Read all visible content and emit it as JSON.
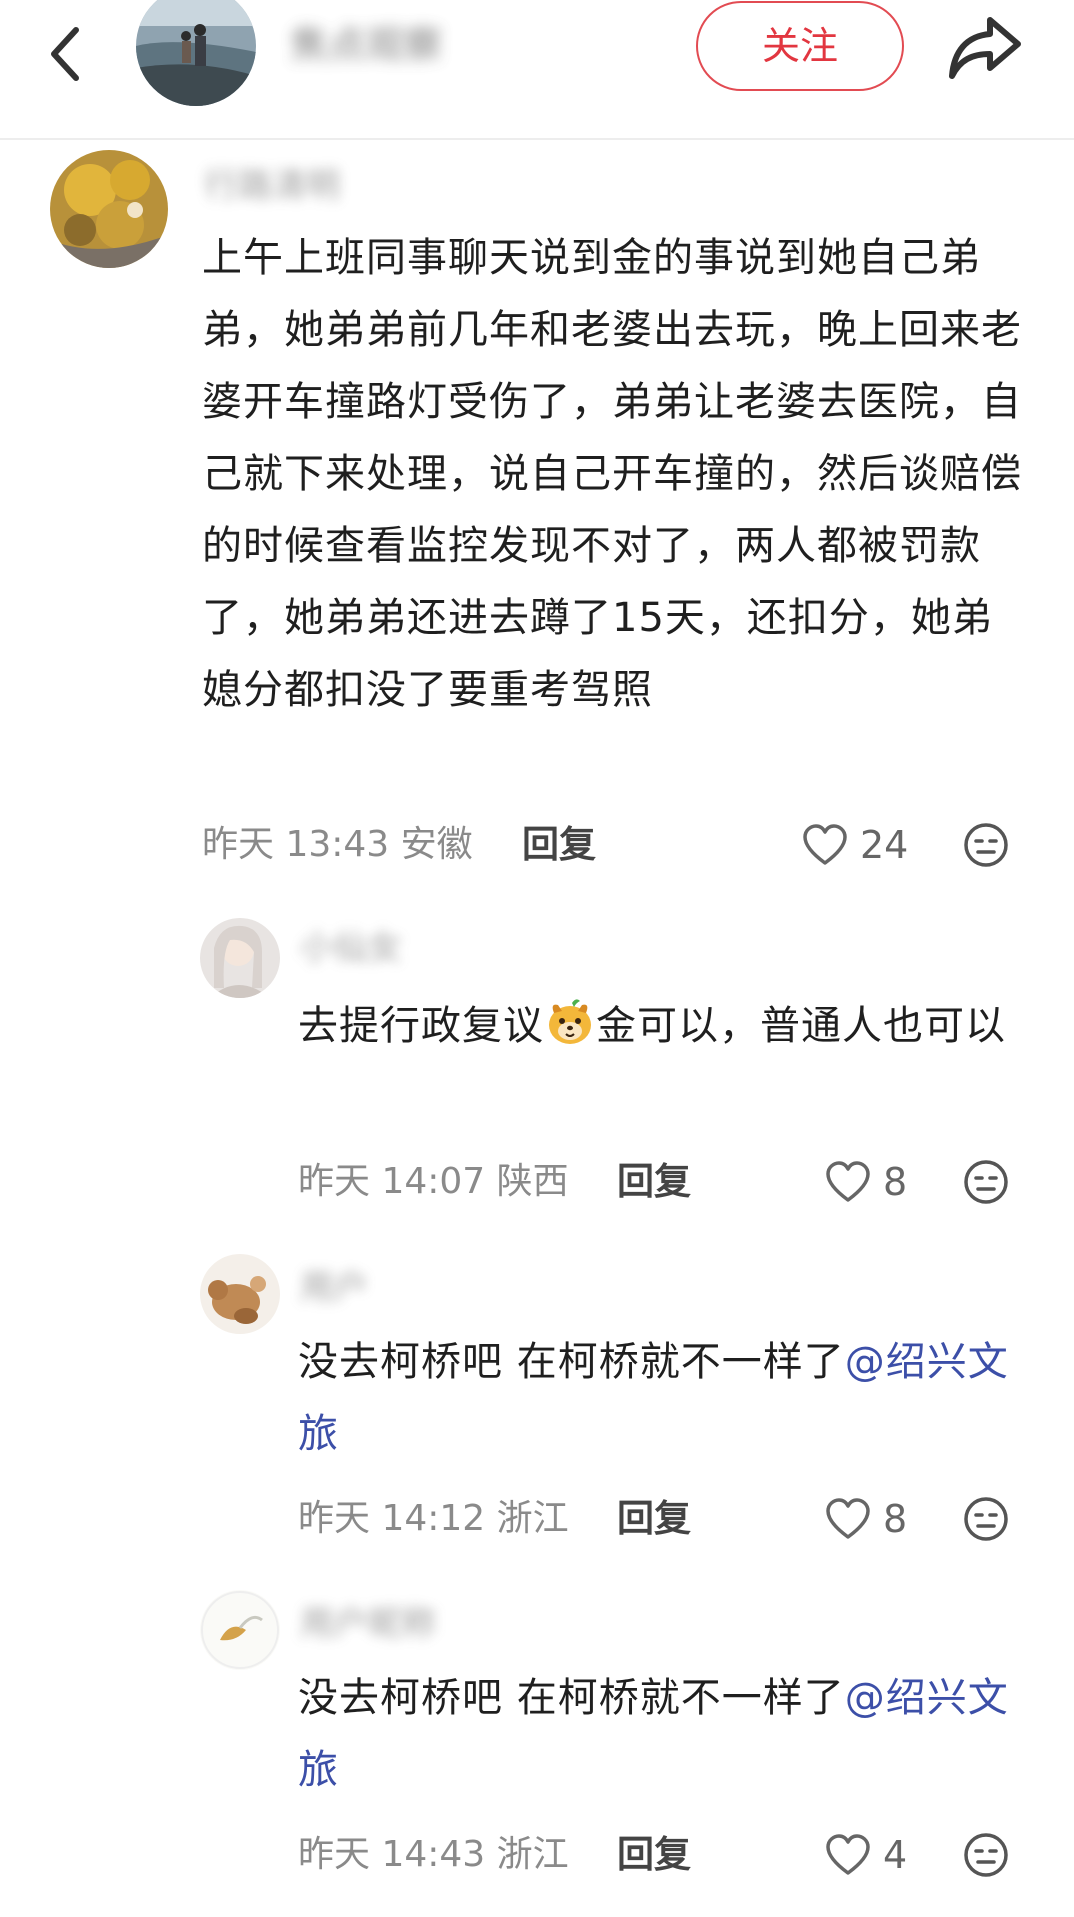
{
  "header": {
    "username": "焦点观察",
    "follow_label": "关注"
  },
  "comments": [
    {
      "username": "行路清明",
      "text": "上午上班同事聊天说到金的事说到她自己弟弟，她弟弟前几年和老婆出去玩，晚上回来老婆开车撞路灯受伤了，弟弟让老婆去医院，自己就下来处理，说自己开车撞的，然后谈赔偿的时候查看监控发现不对了，两人都被罚款了，她弟弟还进去蹲了15天，还扣分，她弟媳分都扣没了要重考驾照",
      "time": "昨天 13:43",
      "location": "安徽",
      "reply_label": "回复",
      "likes": "24"
    },
    {
      "username": "小仙女",
      "text_before": "去提行政复议",
      "text_after": "金可以，普通人也可以",
      "time": "昨天 14:07",
      "location": "陕西",
      "reply_label": "回复",
      "likes": "8"
    },
    {
      "username": "用户",
      "text": "没去柯桥吧 在柯桥就不一样了",
      "mention": "@绍兴文旅",
      "time": "昨天 14:12",
      "location": "浙江",
      "reply_label": "回复",
      "likes": "8"
    },
    {
      "username": "用户昵称",
      "text": "没去柯桥吧 在柯桥就不一样了",
      "mention": "@绍兴文旅",
      "time": "昨天 14:43",
      "location": "浙江",
      "reply_label": "回复",
      "likes": "4"
    }
  ],
  "colors": {
    "follow": "#e23640",
    "mention": "#3c4fa8",
    "meta": "#8a8a8a"
  },
  "icons": [
    "back-arrow-icon",
    "share-icon",
    "heart-icon",
    "emoji-face-icon"
  ]
}
